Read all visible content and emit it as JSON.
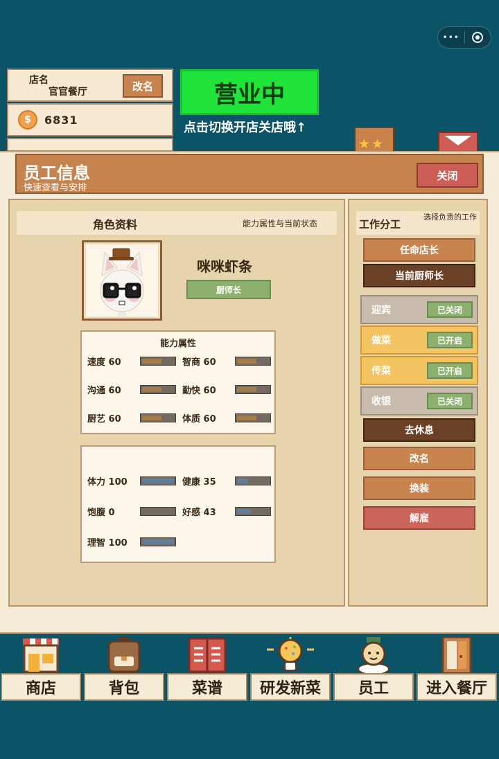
{
  "top_hud": {
    "shop_name_label": "店名",
    "shop_name": "官官餐厅",
    "rename_button": "改名",
    "coins": "6831",
    "coin_symbol": "$",
    "business_status": "营业中",
    "business_hint": "点击切换开店关店哦↑"
  },
  "capsule": {
    "menu_glyph": "•••"
  },
  "modal": {
    "title": "员工信息",
    "subtitle": "快速查看与安排",
    "close_button": "关闭",
    "profile": {
      "header": "角色资料",
      "header_note": "能力属性与当前状态",
      "character_name": "咪咪虾条",
      "role": "厨师长"
    },
    "abilities": {
      "title": "能力属性",
      "items": [
        {
          "label": "速度 60",
          "value": 60
        },
        {
          "label": "智商 60",
          "value": 60
        },
        {
          "label": "沟通 60",
          "value": 60
        },
        {
          "label": "勤快 60",
          "value": 60
        },
        {
          "label": "厨艺 60",
          "value": 60
        },
        {
          "label": "体质 60",
          "value": 60
        }
      ]
    },
    "status": {
      "items": [
        {
          "label": "体力 100",
          "value": 100
        },
        {
          "label": "健康 35",
          "value": 35
        },
        {
          "label": "饱腹 0",
          "value": 0
        },
        {
          "label": "好感 43",
          "value": 43
        },
        {
          "label": "理智 100",
          "value": 100
        }
      ]
    },
    "work": {
      "header": "工作分工",
      "header_note": "选择负责的工作",
      "appoint_manager": "任命店长",
      "current_role": "当前厨师长",
      "duties": [
        {
          "name": "迎宾",
          "state": "已关闭",
          "on": false
        },
        {
          "name": "做菜",
          "state": "已开启",
          "on": true
        },
        {
          "name": "传菜",
          "state": "已开启",
          "on": true
        },
        {
          "name": "收银",
          "state": "已关闭",
          "on": false
        }
      ],
      "rest_button": "去休息",
      "rename_button": "改名",
      "outfit_button": "换装",
      "fire_button": "解雇"
    }
  },
  "nav": {
    "items": [
      {
        "label": "商店",
        "icon": "shop-icon"
      },
      {
        "label": "背包",
        "icon": "backpack-icon"
      },
      {
        "label": "菜谱",
        "icon": "recipe-book-icon"
      },
      {
        "label": "研发新菜",
        "icon": "lightbulb-icon"
      },
      {
        "label": "员工",
        "icon": "staff-icon"
      },
      {
        "label": "进入餐厅",
        "icon": "door-icon"
      }
    ]
  },
  "colors": {
    "background": "#0b5468",
    "status_green": "#21e43a",
    "button_tan": "#c8834e",
    "button_dark": "#6a4126",
    "button_red": "#cc665a",
    "duty_on": "#f3c461",
    "duty_off": "#c9bcad",
    "badge_green": "#8db06f"
  }
}
